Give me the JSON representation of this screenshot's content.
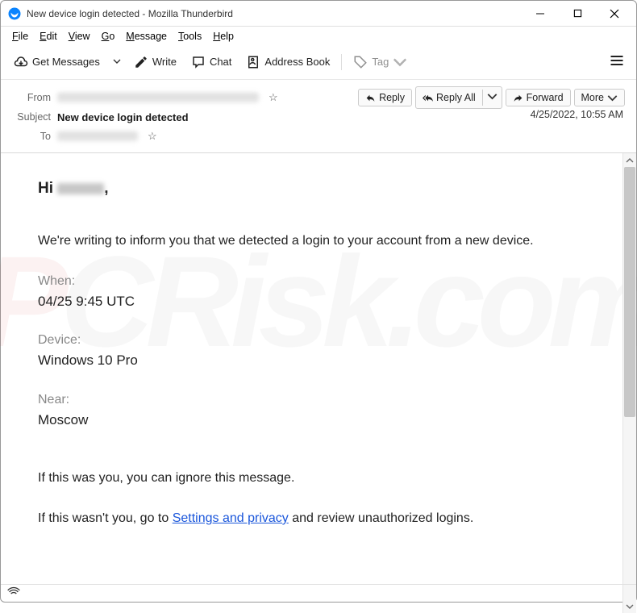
{
  "window": {
    "title": "New device login detected - Mozilla Thunderbird"
  },
  "menubar": {
    "file": "File",
    "edit": "Edit",
    "view": "View",
    "go": "Go",
    "message": "Message",
    "tools": "Tools",
    "help": "Help"
  },
  "toolbar": {
    "get_messages": "Get Messages",
    "write": "Write",
    "chat": "Chat",
    "address_book": "Address Book",
    "tag": "Tag"
  },
  "message_header": {
    "from_label": "From",
    "subject_label": "Subject",
    "to_label": "To",
    "subject_value": "New device login detected",
    "timestamp": "4/25/2022, 10:55 AM"
  },
  "actions": {
    "reply": "Reply",
    "reply_all": "Reply All",
    "forward": "Forward",
    "more": "More"
  },
  "body": {
    "greeting_prefix": "Hi ",
    "greeting_suffix": ",",
    "intro": "We're writing to inform you that we detected a login to your account from a new device.",
    "when_label": "When:",
    "when_value": "04/25 9:45 UTC",
    "device_label": "Device:",
    "device_value": "Windows 10 Pro",
    "near_label": "Near:",
    "near_value": "Moscow",
    "ignore_line": "If this was you, you can ignore this message.",
    "not_you_prefix": "If this wasn't you, go to ",
    "settings_link": "Settings and privacy",
    "not_you_suffix": " and review unauthorized logins."
  }
}
